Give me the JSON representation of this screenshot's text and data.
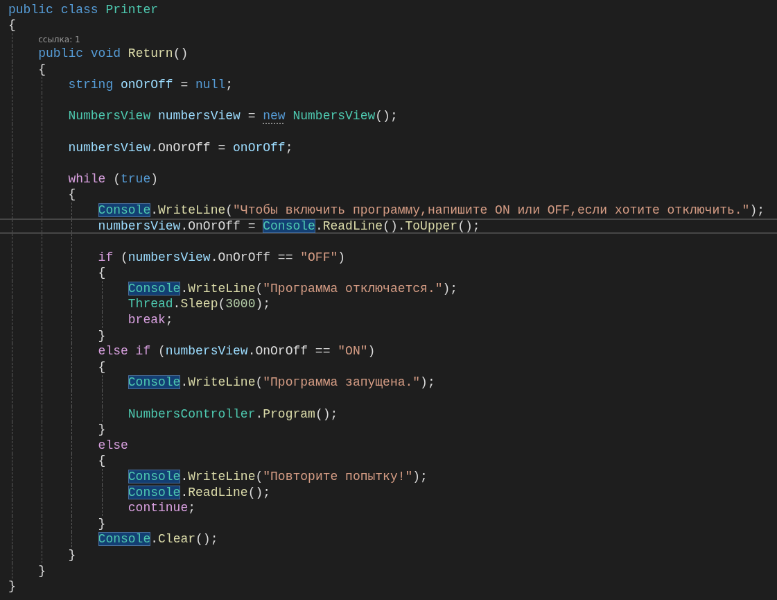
{
  "editor": {
    "lines": [
      {
        "tokens": [
          {
            "kind": "kw",
            "text": "public "
          },
          {
            "kind": "kw",
            "text": "class "
          },
          {
            "kind": "type",
            "text": "Printer"
          }
        ]
      },
      {
        "tokens": [
          {
            "kind": "p",
            "text": "{"
          }
        ],
        "children": [
          {
            "kind": "codelens",
            "tokens": [
              {
                "kind": "lens",
                "text": "ссылка: 1"
              }
            ]
          },
          {
            "tokens": [
              {
                "kind": "kw",
                "text": "public "
              },
              {
                "kind": "kw",
                "text": "void "
              },
              {
                "kind": "method",
                "text": "Return"
              },
              {
                "kind": "p",
                "text": "()"
              }
            ]
          },
          {
            "tokens": [
              {
                "kind": "p",
                "text": "{"
              }
            ],
            "children": [
              {
                "tokens": [
                  {
                    "kind": "kw",
                    "text": "string "
                  },
                  {
                    "kind": "var",
                    "text": "onOrOff"
                  },
                  {
                    "kind": "p",
                    "text": " = "
                  },
                  {
                    "kind": "kw",
                    "text": "null"
                  },
                  {
                    "kind": "p",
                    "text": ";"
                  }
                ]
              },
              {
                "kind": "blank"
              },
              {
                "tokens": [
                  {
                    "kind": "type",
                    "text": "NumbersView "
                  },
                  {
                    "kind": "var",
                    "text": "numbersView"
                  },
                  {
                    "kind": "p",
                    "text": " = "
                  },
                  {
                    "kind": "kw-hint",
                    "text": "new"
                  },
                  {
                    "kind": "type",
                    "text": " NumbersView"
                  },
                  {
                    "kind": "p",
                    "text": "();"
                  }
                ]
              },
              {
                "kind": "blank"
              },
              {
                "tokens": [
                  {
                    "kind": "var",
                    "text": "numbersView"
                  },
                  {
                    "kind": "p",
                    "text": ".OnOrOff = "
                  },
                  {
                    "kind": "var",
                    "text": "onOrOff"
                  },
                  {
                    "kind": "p",
                    "text": ";"
                  }
                ]
              },
              {
                "kind": "blank"
              },
              {
                "tokens": [
                  {
                    "kind": "ctrl",
                    "text": "while"
                  },
                  {
                    "kind": "p",
                    "text": " ("
                  },
                  {
                    "kind": "kw",
                    "text": "true"
                  },
                  {
                    "kind": "p",
                    "text": ")"
                  }
                ]
              },
              {
                "tokens": [
                  {
                    "kind": "p",
                    "text": "{"
                  }
                ],
                "children": [
                  {
                    "tokens": [
                      {
                        "kind": "type-hl",
                        "text": "Console"
                      },
                      {
                        "kind": "p",
                        "text": "."
                      },
                      {
                        "kind": "method",
                        "text": "WriteLine"
                      },
                      {
                        "kind": "p",
                        "text": "("
                      },
                      {
                        "kind": "str",
                        "text": "\"Чтобы включить программу,напишите ON или OFF,если хотите отключить.\""
                      },
                      {
                        "kind": "p",
                        "text": ");"
                      }
                    ]
                  },
                  {
                    "current": true,
                    "tokens": [
                      {
                        "kind": "var",
                        "text": "numbersView"
                      },
                      {
                        "kind": "p",
                        "text": ".OnOrOff = "
                      },
                      {
                        "kind": "type-hl",
                        "text": "Console"
                      },
                      {
                        "kind": "p",
                        "text": "."
                      },
                      {
                        "kind": "method",
                        "text": "ReadLine"
                      },
                      {
                        "kind": "p",
                        "text": "()."
                      },
                      {
                        "kind": "method",
                        "text": "ToUpper"
                      },
                      {
                        "kind": "p",
                        "text": "();"
                      }
                    ]
                  },
                  {
                    "kind": "blank"
                  },
                  {
                    "tokens": [
                      {
                        "kind": "ctrl",
                        "text": "if"
                      },
                      {
                        "kind": "p",
                        "text": " ("
                      },
                      {
                        "kind": "var",
                        "text": "numbersView"
                      },
                      {
                        "kind": "p",
                        "text": ".OnOrOff == "
                      },
                      {
                        "kind": "str",
                        "text": "\"OFF\""
                      },
                      {
                        "kind": "p",
                        "text": ")"
                      }
                    ]
                  },
                  {
                    "tokens": [
                      {
                        "kind": "p",
                        "text": "{"
                      }
                    ],
                    "children": [
                      {
                        "tokens": [
                          {
                            "kind": "type-hl",
                            "text": "Console"
                          },
                          {
                            "kind": "p",
                            "text": "."
                          },
                          {
                            "kind": "method",
                            "text": "WriteLine"
                          },
                          {
                            "kind": "p",
                            "text": "("
                          },
                          {
                            "kind": "str",
                            "text": "\"Программа отключается.\""
                          },
                          {
                            "kind": "p",
                            "text": ");"
                          }
                        ]
                      },
                      {
                        "tokens": [
                          {
                            "kind": "type",
                            "text": "Thread"
                          },
                          {
                            "kind": "p",
                            "text": "."
                          },
                          {
                            "kind": "method",
                            "text": "Sleep"
                          },
                          {
                            "kind": "p",
                            "text": "("
                          },
                          {
                            "kind": "num",
                            "text": "3000"
                          },
                          {
                            "kind": "p",
                            "text": ");"
                          }
                        ]
                      },
                      {
                        "tokens": [
                          {
                            "kind": "ctrl",
                            "text": "break"
                          },
                          {
                            "kind": "p",
                            "text": ";"
                          }
                        ]
                      }
                    ]
                  },
                  {
                    "tokens": [
                      {
                        "kind": "p",
                        "text": "}"
                      }
                    ]
                  },
                  {
                    "tokens": [
                      {
                        "kind": "ctrl",
                        "text": "else "
                      },
                      {
                        "kind": "ctrl",
                        "text": "if"
                      },
                      {
                        "kind": "p",
                        "text": " ("
                      },
                      {
                        "kind": "var",
                        "text": "numbersView"
                      },
                      {
                        "kind": "p",
                        "text": ".OnOrOff == "
                      },
                      {
                        "kind": "str",
                        "text": "\"ON\""
                      },
                      {
                        "kind": "p",
                        "text": ")"
                      }
                    ]
                  },
                  {
                    "tokens": [
                      {
                        "kind": "p",
                        "text": "{"
                      }
                    ],
                    "children": [
                      {
                        "tokens": [
                          {
                            "kind": "type-hl",
                            "text": "Console"
                          },
                          {
                            "kind": "p",
                            "text": "."
                          },
                          {
                            "kind": "method",
                            "text": "WriteLine"
                          },
                          {
                            "kind": "p",
                            "text": "("
                          },
                          {
                            "kind": "str",
                            "text": "\"Программа запущена.\""
                          },
                          {
                            "kind": "p",
                            "text": ");"
                          }
                        ]
                      },
                      {
                        "kind": "blank"
                      },
                      {
                        "tokens": [
                          {
                            "kind": "type",
                            "text": "NumbersController"
                          },
                          {
                            "kind": "p",
                            "text": "."
                          },
                          {
                            "kind": "method",
                            "text": "Program"
                          },
                          {
                            "kind": "p",
                            "text": "();"
                          }
                        ]
                      }
                    ]
                  },
                  {
                    "tokens": [
                      {
                        "kind": "p",
                        "text": "}"
                      }
                    ]
                  },
                  {
                    "tokens": [
                      {
                        "kind": "ctrl",
                        "text": "else"
                      }
                    ]
                  },
                  {
                    "tokens": [
                      {
                        "kind": "p",
                        "text": "{"
                      }
                    ],
                    "children": [
                      {
                        "tokens": [
                          {
                            "kind": "type-hl",
                            "text": "Console"
                          },
                          {
                            "kind": "p",
                            "text": "."
                          },
                          {
                            "kind": "method",
                            "text": "WriteLine"
                          },
                          {
                            "kind": "p",
                            "text": "("
                          },
                          {
                            "kind": "str",
                            "text": "\"Повторите попытку!\""
                          },
                          {
                            "kind": "p",
                            "text": ");"
                          }
                        ]
                      },
                      {
                        "tokens": [
                          {
                            "kind": "type-hl",
                            "text": "Console"
                          },
                          {
                            "kind": "p",
                            "text": "."
                          },
                          {
                            "kind": "method",
                            "text": "ReadLine"
                          },
                          {
                            "kind": "p",
                            "text": "();"
                          }
                        ]
                      },
                      {
                        "tokens": [
                          {
                            "kind": "ctrl",
                            "text": "continue"
                          },
                          {
                            "kind": "p",
                            "text": ";"
                          }
                        ]
                      }
                    ]
                  },
                  {
                    "tokens": [
                      {
                        "kind": "p",
                        "text": "}"
                      }
                    ]
                  },
                  {
                    "tokens": [
                      {
                        "kind": "type-hl",
                        "text": "Console"
                      },
                      {
                        "kind": "p",
                        "text": "."
                      },
                      {
                        "kind": "method",
                        "text": "Clear"
                      },
                      {
                        "kind": "p",
                        "text": "();"
                      }
                    ]
                  }
                ]
              },
              {
                "tokens": [
                  {
                    "kind": "p",
                    "text": "}"
                  }
                ]
              }
            ]
          },
          {
            "tokens": [
              {
                "kind": "p",
                "text": "}"
              }
            ]
          }
        ]
      },
      {
        "tokens": [
          {
            "kind": "p",
            "text": "}"
          }
        ]
      }
    ]
  }
}
